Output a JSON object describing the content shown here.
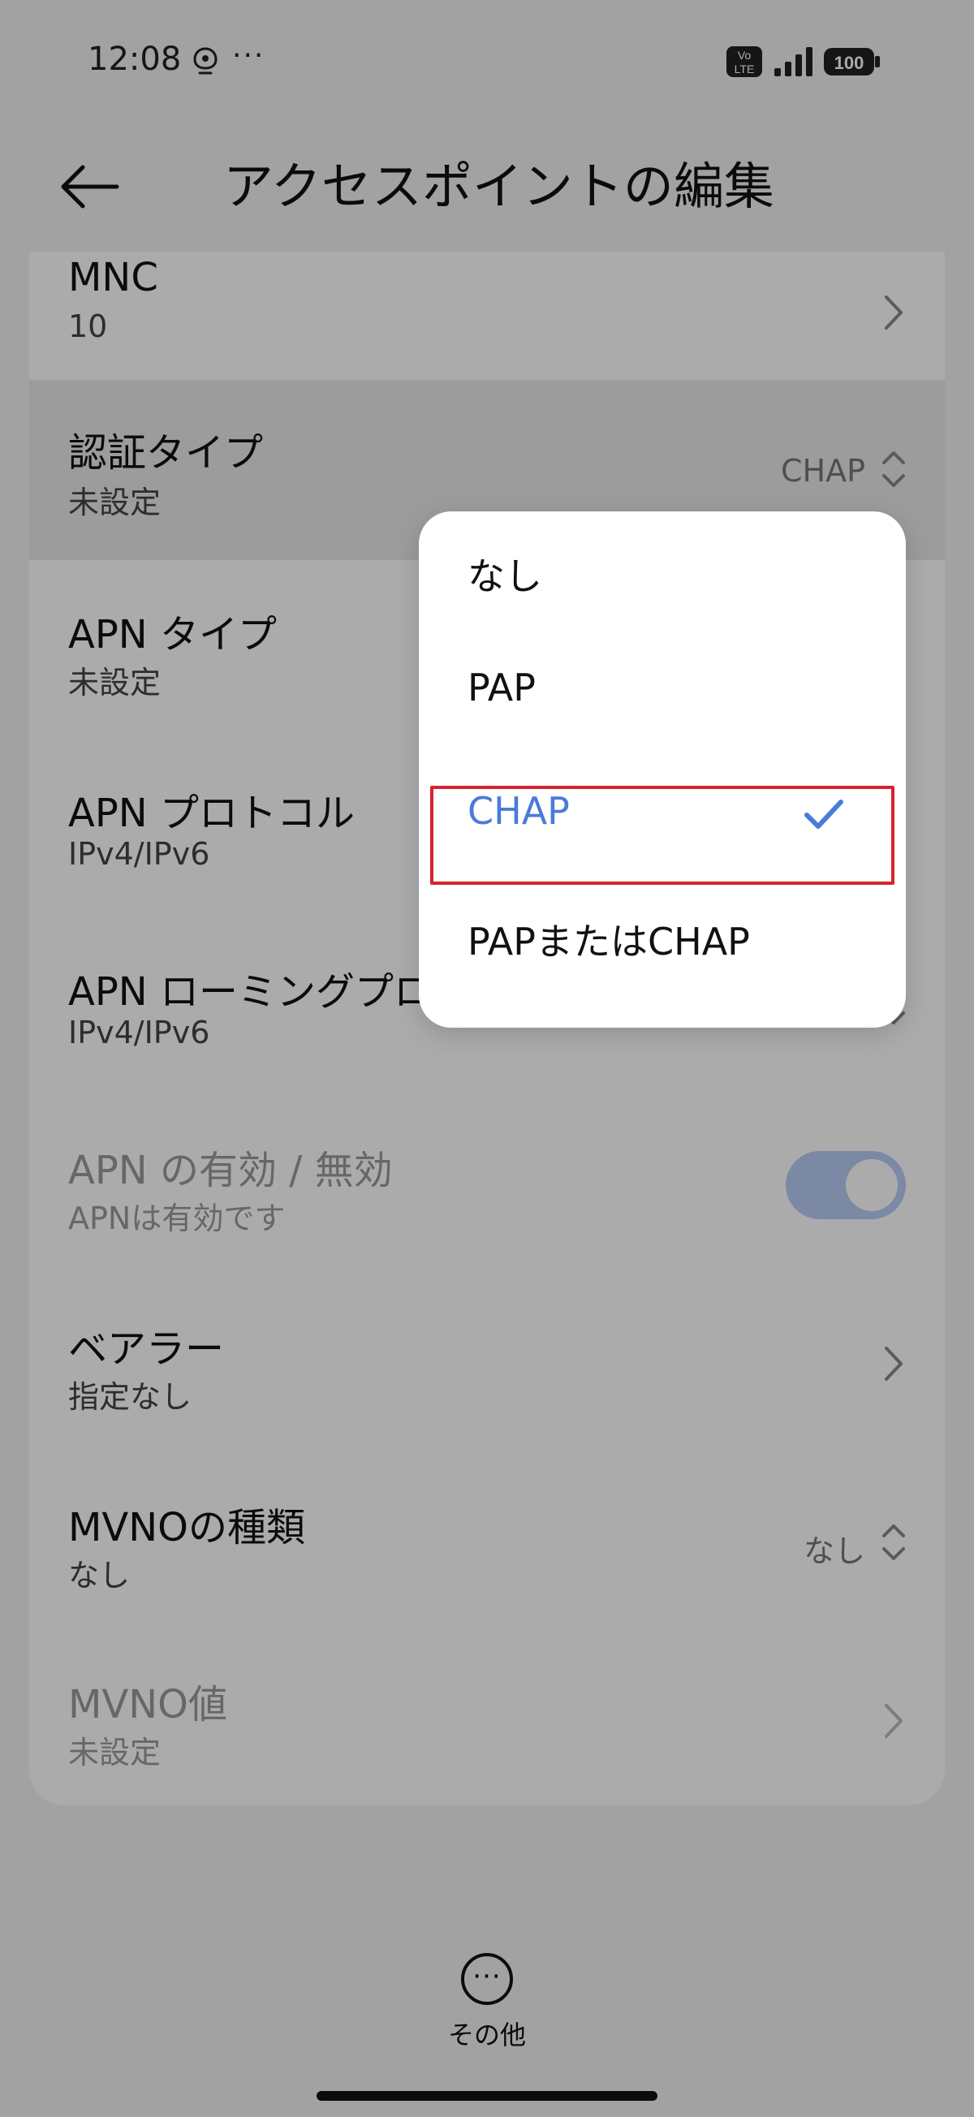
{
  "status_bar": {
    "time": "12:08",
    "more": "···",
    "volte_line1": "Vo",
    "volte_line2": "LTE",
    "battery": "100"
  },
  "header": {
    "title": "アクセスポイントの編集",
    "back_icon": "arrow-left-icon"
  },
  "rows": [
    {
      "title": "MNC",
      "subtitle": "10",
      "control": "chevron"
    },
    {
      "title": "認証タイプ",
      "subtitle": "未設定",
      "value": "CHAP",
      "control": "picker"
    },
    {
      "title": "APN タイプ",
      "subtitle": "未設定",
      "control": "chevron"
    },
    {
      "title": "APN プロトコル",
      "subtitle": "IPv4/IPv6",
      "control": "picker"
    },
    {
      "title": "APN ローミングプロ",
      "subtitle": "IPv4/IPv6",
      "control": "picker"
    },
    {
      "title": "APN の有効 / 無効",
      "subtitle": "APNは有効です",
      "control": "toggle",
      "toggle_on": true,
      "disabled": true
    },
    {
      "title": "ベアラー",
      "subtitle": "指定なし",
      "control": "chevron"
    },
    {
      "title": "MVNOの種類",
      "subtitle": "なし",
      "value": "なし",
      "control": "picker"
    },
    {
      "title": "MVNO値",
      "subtitle": "未設定",
      "control": "chevron",
      "disabled": true
    }
  ],
  "menu": {
    "options": [
      "なし",
      "PAP",
      "CHAP",
      "PAPまたはCHAP"
    ],
    "selected": "CHAP"
  },
  "bottom": {
    "more_label": "その他",
    "more_dots": "···"
  },
  "colors": {
    "accent": "#4a7bd8",
    "highlight_border": "#d6232e",
    "background": "#f2f2f2"
  }
}
